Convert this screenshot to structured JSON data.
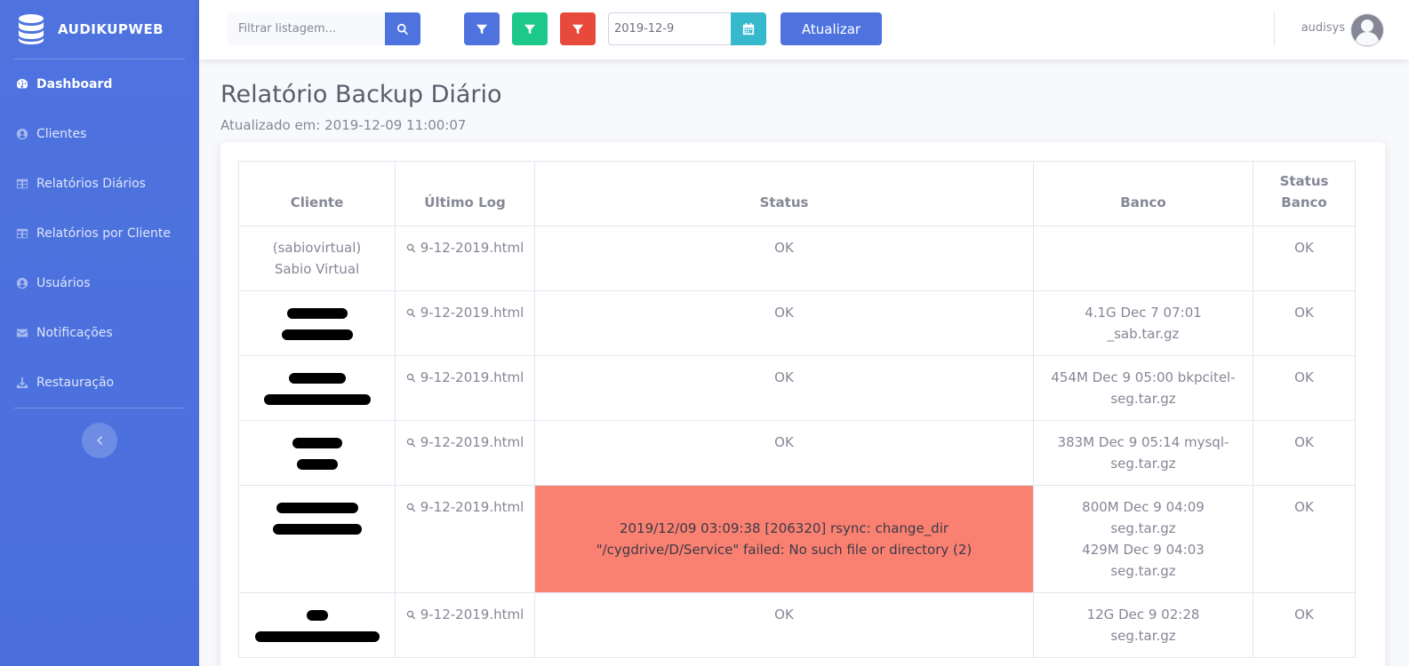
{
  "brand": {
    "name": "AUDIKUPWEB"
  },
  "sidebar": {
    "items": [
      {
        "label": "Dashboard",
        "icon": "tachometer-icon",
        "active": true
      },
      {
        "label": "Clientes",
        "icon": "user-circle-icon"
      },
      {
        "label": "Relatórios Diários",
        "icon": "table-icon"
      },
      {
        "label": "Relatórios por Cliente",
        "icon": "table-icon"
      },
      {
        "label": "Usuários",
        "icon": "user-circle-icon"
      },
      {
        "label": "Notificações",
        "icon": "envelope-icon"
      },
      {
        "label": "Restauração",
        "icon": "download-icon"
      }
    ]
  },
  "topbar": {
    "search_placeholder": "Filtrar listagem...",
    "date_value": "2019-12-9",
    "update_label": "Atualizar",
    "username": "audisys"
  },
  "page": {
    "title": "Relatório Backup Diário",
    "updated": "Atualizado em: 2019-12-09 11:00:07"
  },
  "table": {
    "headers": [
      "Cliente",
      "Último Log",
      "Status",
      "Banco",
      "Status Banco"
    ],
    "rows": [
      {
        "cliente": "(sabiovirtual) Sabio Virtual",
        "log": "9-12-2019.html",
        "status": "OK",
        "banco": "",
        "status_banco": "OK"
      },
      {
        "cliente": "",
        "log": "9-12-2019.html",
        "status": "OK",
        "banco": "4.1G Dec 7 07:01 _sab.tar.gz",
        "status_banco": "OK"
      },
      {
        "cliente": "",
        "log": "9-12-2019.html",
        "status": "OK",
        "banco": "454M Dec 9 05:00 bkpcitel- seg.tar.gz",
        "status_banco": "OK"
      },
      {
        "cliente": "",
        "log": "9-12-2019.html",
        "status": "OK",
        "banco": "383M Dec 9 05:14 mysql- seg.tar.gz",
        "status_banco": "OK"
      },
      {
        "cliente": "",
        "log": "9-12-2019.html",
        "status": "2019/12/09 03:09:38 [206320] rsync: change_dir \"/cygdrive/D/Service\" failed: No such file or directory (2)",
        "banco": "800M Dec 9 04:09 seg.tar.gz",
        "banco2": "429M Dec 9 04:03 seg.tar.gz",
        "status_banco": "OK"
      },
      {
        "cliente": "",
        "log": "9-12-2019.html",
        "status": "OK",
        "banco": "12G Dec 9 02:28 seg.tar.gz",
        "status_banco": "OK"
      }
    ]
  },
  "colors": {
    "primary": "#4e73df",
    "success": "#1cc88a",
    "danger": "#e74a3b",
    "info": "#36b9cc",
    "error_row": "#fa8072"
  }
}
